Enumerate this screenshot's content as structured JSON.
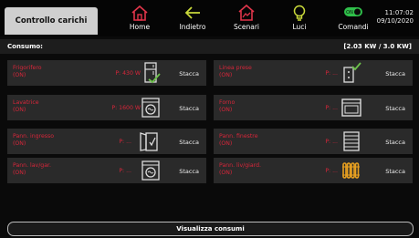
{
  "top": {
    "title": "Controllo carichi",
    "nav": [
      {
        "label": "Home",
        "icon": "home-icon",
        "color": "#e0354a"
      },
      {
        "label": "Indietro",
        "icon": "back-arrow-icon",
        "color": "#c9d93a"
      },
      {
        "label": "Scenari",
        "icon": "scenes-icon",
        "color": "#e0354a"
      },
      {
        "label": "Luci",
        "icon": "lightbulb-icon",
        "color": "#c9d93a"
      },
      {
        "label": "Comandi",
        "icon": "toggle-switch-icon",
        "color": "#2fbf4a",
        "toggle_text": "ON"
      }
    ],
    "time": "11:07:02",
    "date": "09/10/2020"
  },
  "header": {
    "label": "Consumo:",
    "value": "[2.03 KW / 3.0 KW]"
  },
  "loads": [
    {
      "name": "Frigorifero",
      "status": "(ON)",
      "power": "P: 430 W",
      "icon": "fridge-icon",
      "button": "Stacca"
    },
    {
      "name": "Linea prese",
      "status": "(ON)",
      "power": "P: ...",
      "icon": "socket-icon",
      "button": "Stacca"
    },
    {
      "name": "Lavatrice",
      "status": "(ON)",
      "power": "P: 1600 W",
      "icon": "washing-machine-icon",
      "button": "Stacca"
    },
    {
      "name": "Forno",
      "status": "(ON)",
      "power": "P: ...",
      "icon": "oven-icon",
      "button": "Stacca"
    },
    {
      "name": "Pann. ingresso",
      "status": "(ON)",
      "power": "P: ...",
      "icon": "door-icon",
      "button": "Stacca"
    },
    {
      "name": "Pann. finestre",
      "status": "(ON)",
      "power": "P: ...",
      "icon": "window-blind-icon",
      "button": "Stacca"
    },
    {
      "name": "Pann. lav/gar.",
      "status": "(ON)",
      "power": "P: ...",
      "icon": "washing-machine-icon",
      "button": "Stacca"
    },
    {
      "name": "Pann. liv/giard.",
      "status": "(ON)",
      "power": "P: ...",
      "icon": "radiator-icon",
      "button": "Stacca"
    }
  ],
  "bottom_button": "Visualizza consumi"
}
